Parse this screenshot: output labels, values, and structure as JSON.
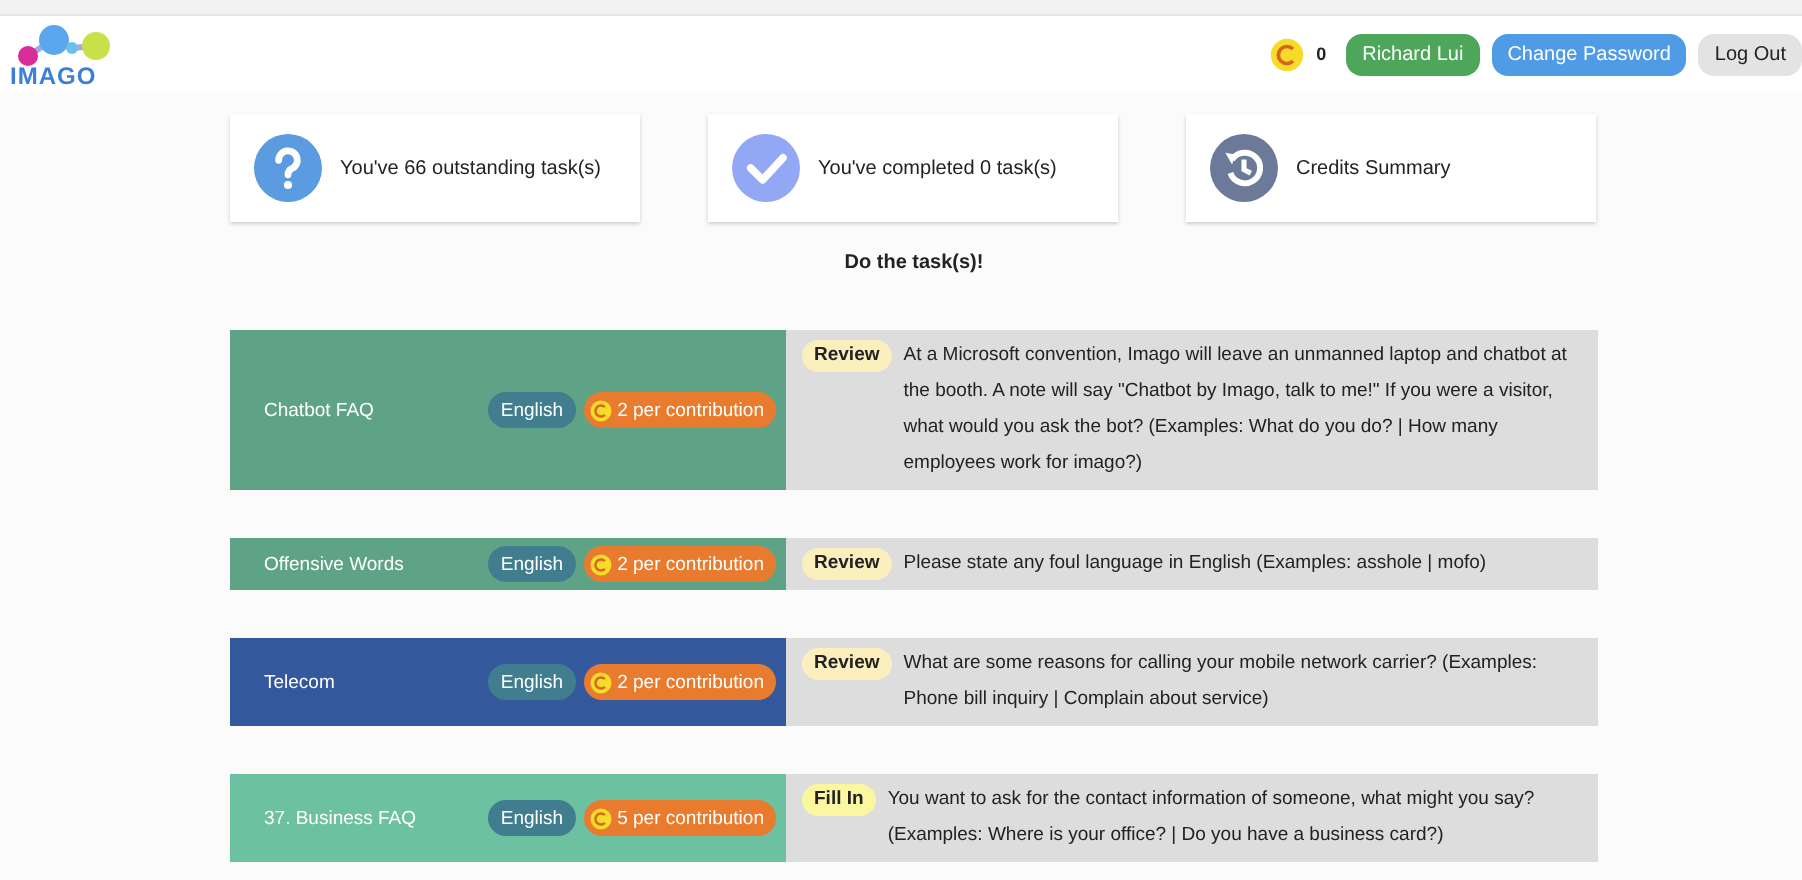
{
  "header": {
    "logo_text": "IMAGO",
    "credits": "0",
    "user_button": "Richard Lui",
    "password_button": "Change Password",
    "logout_button": "Log Out"
  },
  "summary_cards": [
    {
      "kind": "outstanding",
      "label": "You've 66 outstanding task(s)"
    },
    {
      "kind": "completed",
      "label": "You've completed 0 task(s)"
    },
    {
      "kind": "credits",
      "label": "Credits Summary"
    }
  ],
  "section_title": "Do the task(s)!",
  "tasks": [
    {
      "title": "Chatbot FAQ",
      "color": "#5fa386",
      "language": "English",
      "reward": "2 per contribution",
      "type": {
        "label": "Review",
        "color": "#fbefbe"
      },
      "prompt": "At a Microsoft convention, Imago will leave an unmanned laptop and chatbot at the booth. A note will say \"Chatbot by Imago, talk to me!\" If you were a visitor, what would you ask the bot? (Examples: What do you do? | How many employees work for imago?)"
    },
    {
      "title": "Offensive Words",
      "color": "#5fa386",
      "language": "English",
      "reward": "2 per contribution",
      "type": {
        "label": "Review",
        "color": "#fbefbe"
      },
      "prompt": "Please state any foul language in English (Examples: asshole | mofo)"
    },
    {
      "title": "Telecom",
      "color": "#34589c",
      "language": "English",
      "reward": "2 per contribution",
      "type": {
        "label": "Review",
        "color": "#fbefbe"
      },
      "prompt": "What are some reasons for calling your mobile network carrier? (Examples: Phone bill inquiry | Complain about service)"
    },
    {
      "title": "37. Business FAQ",
      "color": "#6cc1a0",
      "language": "English",
      "reward": "5 per contribution",
      "type": {
        "label": "Fill In",
        "color": "#fbf7a0"
      },
      "prompt": "You want to ask for the contact information of someone, what might you say? (Examples: Where is your office? | Do you have a business card?)"
    }
  ]
}
